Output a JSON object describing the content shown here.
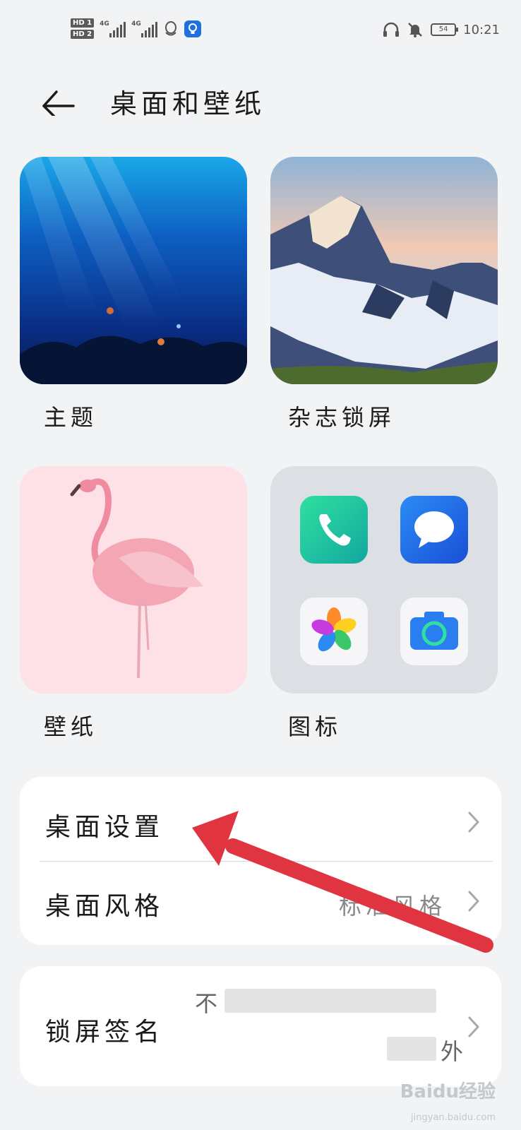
{
  "status_bar": {
    "sim1": "HD 1",
    "sim2": "HD 2",
    "network1": "4G",
    "network2": "4G",
    "battery": "54",
    "time": "10:21"
  },
  "header": {
    "title": "桌面和壁纸"
  },
  "tiles": [
    {
      "label": "主题"
    },
    {
      "label": "杂志锁屏"
    },
    {
      "label": "壁纸"
    },
    {
      "label": "图标"
    }
  ],
  "settings": {
    "desktop_settings": {
      "label": "桌面设置"
    },
    "desktop_style": {
      "label": "桌面风格",
      "value": "标准风格"
    },
    "lock_signature": {
      "label": "锁屏签名",
      "value_line1": "不",
      "value_line2": "外"
    }
  },
  "watermark": {
    "brand": "Baidu经验",
    "url": "jingyan.baidu.com"
  },
  "colors": {
    "background": "#f1f3f5",
    "card": "#ffffff",
    "arrow": "#e03540"
  }
}
